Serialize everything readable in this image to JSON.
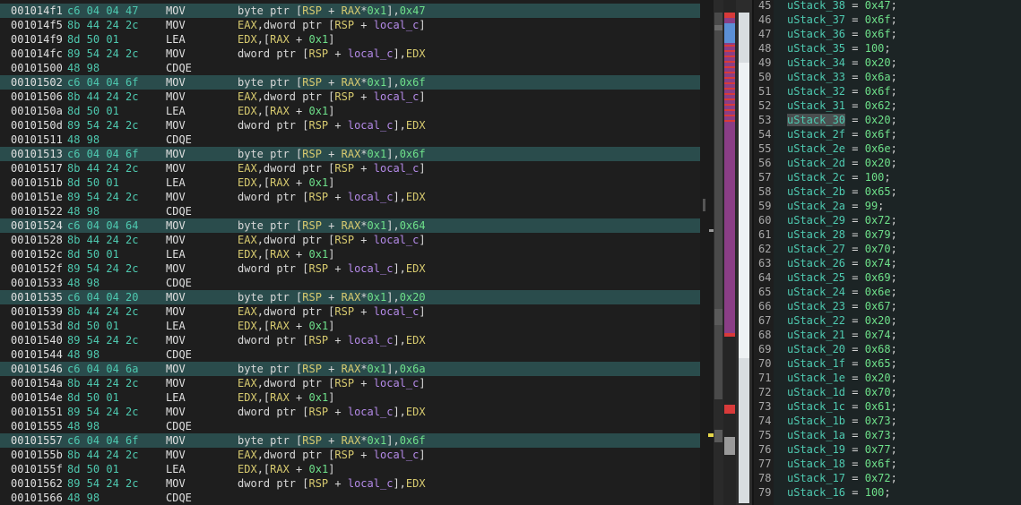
{
  "listing": [
    {
      "addr": "001014f1",
      "bytes": "c6 04 04 47",
      "mn": "MOV",
      "ops": "byte ptr [RSP + RAX*0x1],0x47",
      "hl": true
    },
    {
      "addr": "001014f5",
      "bytes": "8b 44 24 2c",
      "mn": "MOV",
      "ops": "EAX,dword ptr [RSP + local_c]",
      "hl": false
    },
    {
      "addr": "001014f9",
      "bytes": "8d 50 01",
      "mn": "LEA",
      "ops": "EDX,[RAX + 0x1]",
      "hl": false
    },
    {
      "addr": "001014fc",
      "bytes": "89 54 24 2c",
      "mn": "MOV",
      "ops": "dword ptr [RSP + local_c],EDX",
      "hl": false
    },
    {
      "addr": "00101500",
      "bytes": "48 98",
      "mn": "CDQE",
      "ops": "",
      "hl": false
    },
    {
      "addr": "00101502",
      "bytes": "c6 04 04 6f",
      "mn": "MOV",
      "ops": "byte ptr [RSP + RAX*0x1],0x6f",
      "hl": true
    },
    {
      "addr": "00101506",
      "bytes": "8b 44 24 2c",
      "mn": "MOV",
      "ops": "EAX,dword ptr [RSP + local_c]",
      "hl": false
    },
    {
      "addr": "0010150a",
      "bytes": "8d 50 01",
      "mn": "LEA",
      "ops": "EDX,[RAX + 0x1]",
      "hl": false
    },
    {
      "addr": "0010150d",
      "bytes": "89 54 24 2c",
      "mn": "MOV",
      "ops": "dword ptr [RSP + local_c],EDX",
      "hl": false
    },
    {
      "addr": "00101511",
      "bytes": "48 98",
      "mn": "CDQE",
      "ops": "",
      "hl": false
    },
    {
      "addr": "00101513",
      "bytes": "c6 04 04 6f",
      "mn": "MOV",
      "ops": "byte ptr [RSP + RAX*0x1],0x6f",
      "hl": true
    },
    {
      "addr": "00101517",
      "bytes": "8b 44 24 2c",
      "mn": "MOV",
      "ops": "EAX,dword ptr [RSP + local_c]",
      "hl": false
    },
    {
      "addr": "0010151b",
      "bytes": "8d 50 01",
      "mn": "LEA",
      "ops": "EDX,[RAX + 0x1]",
      "hl": false
    },
    {
      "addr": "0010151e",
      "bytes": "89 54 24 2c",
      "mn": "MOV",
      "ops": "dword ptr [RSP + local_c],EDX",
      "hl": false
    },
    {
      "addr": "00101522",
      "bytes": "48 98",
      "mn": "CDQE",
      "ops": "",
      "hl": false
    },
    {
      "addr": "00101524",
      "bytes": "c6 04 04 64",
      "mn": "MOV",
      "ops": "byte ptr [RSP + RAX*0x1],0x64",
      "hl": true
    },
    {
      "addr": "00101528",
      "bytes": "8b 44 24 2c",
      "mn": "MOV",
      "ops": "EAX,dword ptr [RSP + local_c]",
      "hl": false
    },
    {
      "addr": "0010152c",
      "bytes": "8d 50 01",
      "mn": "LEA",
      "ops": "EDX,[RAX + 0x1]",
      "hl": false
    },
    {
      "addr": "0010152f",
      "bytes": "89 54 24 2c",
      "mn": "MOV",
      "ops": "dword ptr [RSP + local_c],EDX",
      "hl": false
    },
    {
      "addr": "00101533",
      "bytes": "48 98",
      "mn": "CDQE",
      "ops": "",
      "hl": false
    },
    {
      "addr": "00101535",
      "bytes": "c6 04 04 20",
      "mn": "MOV",
      "ops": "byte ptr [RSP + RAX*0x1],0x20",
      "hl": true
    },
    {
      "addr": "00101539",
      "bytes": "8b 44 24 2c",
      "mn": "MOV",
      "ops": "EAX,dword ptr [RSP + local_c]",
      "hl": false
    },
    {
      "addr": "0010153d",
      "bytes": "8d 50 01",
      "mn": "LEA",
      "ops": "EDX,[RAX + 0x1]",
      "hl": false
    },
    {
      "addr": "00101540",
      "bytes": "89 54 24 2c",
      "mn": "MOV",
      "ops": "dword ptr [RSP + local_c],EDX",
      "hl": false
    },
    {
      "addr": "00101544",
      "bytes": "48 98",
      "mn": "CDQE",
      "ops": "",
      "hl": false
    },
    {
      "addr": "00101546",
      "bytes": "c6 04 04 6a",
      "mn": "MOV",
      "ops": "byte ptr [RSP + RAX*0x1],0x6a",
      "hl": true
    },
    {
      "addr": "0010154a",
      "bytes": "8b 44 24 2c",
      "mn": "MOV",
      "ops": "EAX,dword ptr [RSP + local_c]",
      "hl": false
    },
    {
      "addr": "0010154e",
      "bytes": "8d 50 01",
      "mn": "LEA",
      "ops": "EDX,[RAX + 0x1]",
      "hl": false
    },
    {
      "addr": "00101551",
      "bytes": "89 54 24 2c",
      "mn": "MOV",
      "ops": "dword ptr [RSP + local_c],EDX",
      "hl": false
    },
    {
      "addr": "00101555",
      "bytes": "48 98",
      "mn": "CDQE",
      "ops": "",
      "hl": false
    },
    {
      "addr": "00101557",
      "bytes": "c6 04 04 6f",
      "mn": "MOV",
      "ops": "byte ptr [RSP + RAX*0x1],0x6f",
      "hl": true
    },
    {
      "addr": "0010155b",
      "bytes": "8b 44 24 2c",
      "mn": "MOV",
      "ops": "EAX,dword ptr [RSP + local_c]",
      "hl": false
    },
    {
      "addr": "0010155f",
      "bytes": "8d 50 01",
      "mn": "LEA",
      "ops": "EDX,[RAX + 0x1]",
      "hl": false
    },
    {
      "addr": "00101562",
      "bytes": "89 54 24 2c",
      "mn": "MOV",
      "ops": "dword ptr [RSP + local_c],EDX",
      "hl": false
    },
    {
      "addr": "00101566",
      "bytes": "48 98",
      "mn": "CDQE",
      "ops": "",
      "hl": false
    }
  ],
  "decompiler": [
    {
      "ln": "45",
      "var": "uStack_38",
      "val": "0x47"
    },
    {
      "ln": "46",
      "var": "uStack_37",
      "val": "0x6f"
    },
    {
      "ln": "47",
      "var": "uStack_36",
      "val": "0x6f"
    },
    {
      "ln": "48",
      "var": "uStack_35",
      "val": "100"
    },
    {
      "ln": "49",
      "var": "uStack_34",
      "val": "0x20"
    },
    {
      "ln": "50",
      "var": "uStack_33",
      "val": "0x6a"
    },
    {
      "ln": "51",
      "var": "uStack_32",
      "val": "0x6f"
    },
    {
      "ln": "52",
      "var": "uStack_31",
      "val": "0x62"
    },
    {
      "ln": "53",
      "var": "uStack_30",
      "val": "0x20",
      "selected": true
    },
    {
      "ln": "54",
      "var": "uStack_2f",
      "val": "0x6f"
    },
    {
      "ln": "55",
      "var": "uStack_2e",
      "val": "0x6e"
    },
    {
      "ln": "56",
      "var": "uStack_2d",
      "val": "0x20"
    },
    {
      "ln": "57",
      "var": "uStack_2c",
      "val": "100"
    },
    {
      "ln": "58",
      "var": "uStack_2b",
      "val": "0x65"
    },
    {
      "ln": "59",
      "var": "uStack_2a",
      "val": "99"
    },
    {
      "ln": "60",
      "var": "uStack_29",
      "val": "0x72"
    },
    {
      "ln": "61",
      "var": "uStack_28",
      "val": "0x79"
    },
    {
      "ln": "62",
      "var": "uStack_27",
      "val": "0x70"
    },
    {
      "ln": "63",
      "var": "uStack_26",
      "val": "0x74"
    },
    {
      "ln": "64",
      "var": "uStack_25",
      "val": "0x69"
    },
    {
      "ln": "65",
      "var": "uStack_24",
      "val": "0x6e"
    },
    {
      "ln": "66",
      "var": "uStack_23",
      "val": "0x67"
    },
    {
      "ln": "67",
      "var": "uStack_22",
      "val": "0x20"
    },
    {
      "ln": "68",
      "var": "uStack_21",
      "val": "0x74"
    },
    {
      "ln": "69",
      "var": "uStack_20",
      "val": "0x68"
    },
    {
      "ln": "70",
      "var": "uStack_1f",
      "val": "0x65"
    },
    {
      "ln": "71",
      "var": "uStack_1e",
      "val": "0x20"
    },
    {
      "ln": "72",
      "var": "uStack_1d",
      "val": "0x70"
    },
    {
      "ln": "73",
      "var": "uStack_1c",
      "val": "0x61"
    },
    {
      "ln": "74",
      "var": "uStack_1b",
      "val": "0x73"
    },
    {
      "ln": "75",
      "var": "uStack_1a",
      "val": "0x73"
    },
    {
      "ln": "76",
      "var": "uStack_19",
      "val": "0x77"
    },
    {
      "ln": "77",
      "var": "uStack_18",
      "val": "0x6f"
    },
    {
      "ln": "78",
      "var": "uStack_17",
      "val": "0x72"
    },
    {
      "ln": "79",
      "var": "uStack_16",
      "val": "100"
    }
  ],
  "colors": {
    "highlight_row": "#2a4c4c",
    "register": "#d7ca6f",
    "number": "#6ee08a",
    "local_var": "#b48ae8",
    "bytes": "#4ec9b0",
    "overview_marker": "#8a3e86",
    "overview_red": "#d83a3a",
    "scroll_thumb": "#5b8fd6",
    "cursor_marker": "#e6d64a"
  }
}
